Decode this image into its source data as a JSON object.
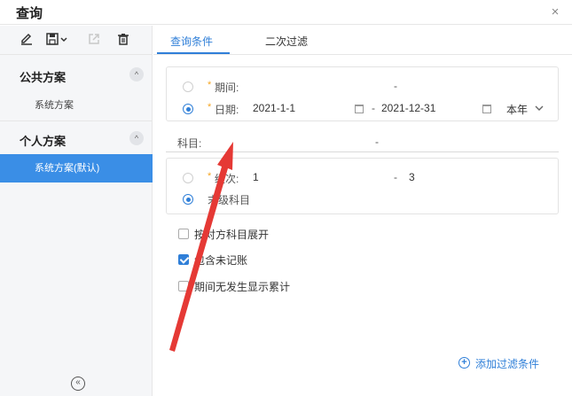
{
  "window": {
    "title": "查询",
    "close_glyph": "×"
  },
  "toolbar": {
    "icons": [
      "edit-icon",
      "save-icon",
      "export-icon",
      "delete-icon"
    ]
  },
  "sidebar": {
    "public_title": "公共方案",
    "public_items": [
      "系统方案"
    ],
    "personal_title": "个人方案",
    "personal_items": [
      "系统方案(默认)"
    ],
    "toggle_glyph": "^",
    "collapse_glyph": "«"
  },
  "tabs": [
    "查询条件",
    "二次过滤"
  ],
  "filters": {
    "period_label": "期间:",
    "period_dash": "-",
    "date_label": "日期:",
    "date_from": "2021-1-1",
    "date_dash": "-",
    "date_to": "2021-12-31",
    "date_preset": "本年",
    "subject_label": "科目:",
    "subject_dash": "-",
    "level_label": "级次:",
    "level_from": "1",
    "level_dash": "-",
    "level_to": "3",
    "leaf_label": "末级科目",
    "required_mark": "*"
  },
  "checkboxes": [
    {
      "label": "按对方科目展开",
      "checked": false
    },
    {
      "label": "包含未记账",
      "checked": true
    },
    {
      "label": "期间无发生显示累计",
      "checked": false
    }
  ],
  "add_filter": {
    "label": "添加过滤条件",
    "glyph": "+"
  },
  "colors": {
    "accent": "#2f7fd8",
    "active_item": "#3a8ee6",
    "arrow": "#e53935",
    "required": "#f5a623"
  }
}
